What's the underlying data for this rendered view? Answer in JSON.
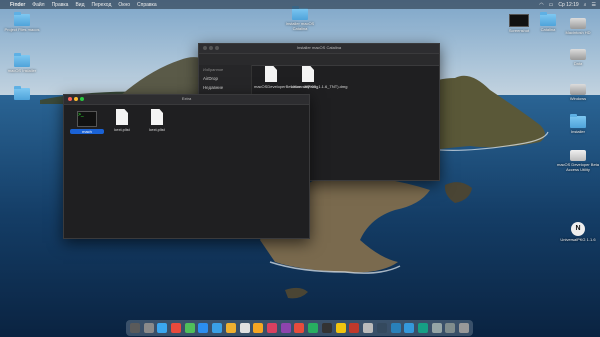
{
  "menubar": {
    "apple": "",
    "items": [
      "Finder",
      "Файл",
      "Правка",
      "Вид",
      "Переход",
      "Окно",
      "Справка"
    ],
    "clock": "Ср 12:19"
  },
  "desktop_icons": {
    "left": [
      "Project Files macos",
      "macOS Installer",
      ""
    ],
    "top_folder": "Installer macOS Catalina",
    "right": [
      "Screenshot",
      "Catalina",
      "Macintosh HD",
      "Data",
      "Windows",
      "Installer",
      "macOS Developer Beta Access Utility",
      "UniversalPKG 1.1.6"
    ]
  },
  "window_back": {
    "title": "Installer macOS Catalina",
    "sidebar": {
      "header": "Избранное",
      "items": [
        "AirDrop",
        "Недавние",
        "Программы"
      ]
    },
    "files": [
      "macOSDeveloperBetaAcc...ility.dmg",
      "UniversalPKG_1.1.6_TNT).dmg"
    ]
  },
  "window_front": {
    "title": "Extra",
    "files": [
      "mach",
      "kext.plist",
      "kext.plist"
    ]
  },
  "dock": {
    "colors": [
      "#5a5a5a",
      "#8a8a8a",
      "#3aa7f0",
      "#e84a3c",
      "#4fbf5a",
      "#2b8ef0",
      "#3aa0e6",
      "#f0b030",
      "#e0e0e0",
      "#f5a623",
      "#d94060",
      "#8e44ad",
      "#e74c3c",
      "#27ae60",
      "#333",
      "#f1c40f",
      "#c0392b",
      "#bbb",
      "#34495e",
      "#2980b9",
      "#3498db",
      "#16a085",
      "#95a5a6",
      "#7f8c8d",
      "#999"
    ]
  }
}
